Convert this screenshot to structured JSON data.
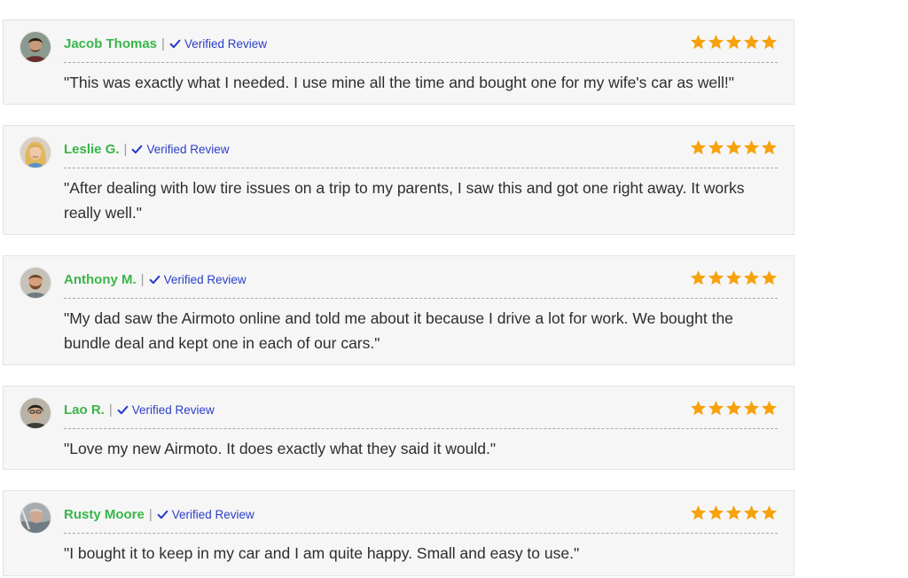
{
  "theme": {
    "name_color": "#3ab54a",
    "verified_color": "#2b3ec8",
    "star_color": "#f7a10b",
    "card_bg": "#f6f6f6"
  },
  "reviews": [
    {
      "name": "Jacob Thomas",
      "separator": "|",
      "verified_label": "Verified Review",
      "rating": 5,
      "text": "\"This was exactly what I needed. I use mine all the time and bought one for my wife's car as well!\""
    },
    {
      "name": "Leslie G.",
      "separator": "|",
      "verified_label": "Verified Review",
      "rating": 5,
      "text": "\"After dealing with low tire issues on a trip to my parents, I saw this and got one right away. It works really well.\""
    },
    {
      "name": "Anthony M.",
      "separator": "|",
      "verified_label": "Verified Review",
      "rating": 5,
      "text": "\"My dad saw the Airmoto online and told me about it because I drive a lot for work. We bought the bundle deal and kept one in each of our cars.\""
    },
    {
      "name": "Lao R.",
      "separator": "|",
      "verified_label": "Verified Review",
      "rating": 5,
      "text": "\"Love my new Airmoto. It does exactly what they said it would.\""
    },
    {
      "name": "Rusty Moore",
      "separator": "|",
      "verified_label": "Verified Review",
      "rating": 5,
      "text": "\"I bought it to keep in my car and I am quite happy. Small and easy to use.\""
    }
  ]
}
